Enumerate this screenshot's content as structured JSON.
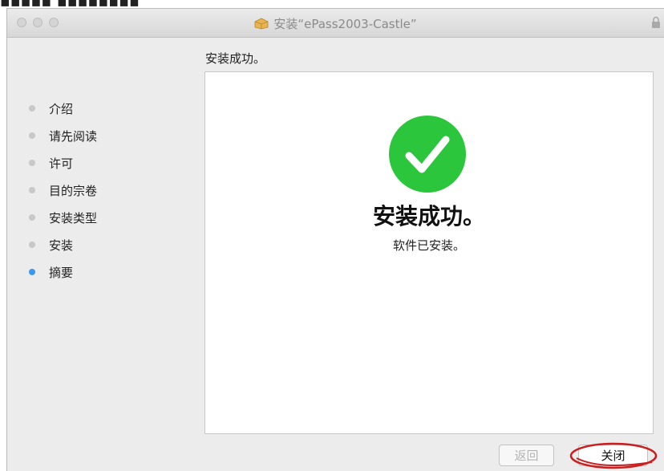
{
  "window": {
    "title": "安装“ePass2003-Castle”"
  },
  "content": {
    "heading": "安装成功。",
    "success_title": "安装成功。",
    "success_message": "软件已安装。"
  },
  "sidebar": {
    "steps": [
      {
        "label": "介绍",
        "active": false
      },
      {
        "label": "请先阅读",
        "active": false
      },
      {
        "label": "许可",
        "active": false
      },
      {
        "label": "目的宗卷",
        "active": false
      },
      {
        "label": "安装类型",
        "active": false
      },
      {
        "label": "安装",
        "active": false
      },
      {
        "label": "摘要",
        "active": true
      }
    ]
  },
  "buttons": {
    "back": "返回",
    "close": "关闭"
  },
  "icons": {
    "window_icon": "package-icon",
    "lock": "lock-icon",
    "success": "check-circle-icon"
  },
  "colors": {
    "success_green": "#2bc63b",
    "active_step": "#3d97ec",
    "annotation_red": "#cc1e1e"
  }
}
